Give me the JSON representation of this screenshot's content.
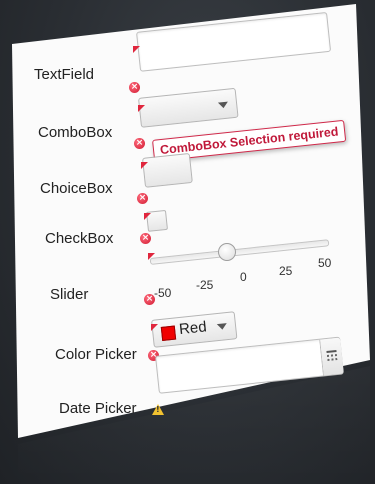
{
  "form": {
    "labels": {
      "textfield": "TextField",
      "combobox": "ComboBox",
      "choicebox": "ChoiceBox",
      "checkbox": "CheckBox",
      "slider": "Slider",
      "colorpicker": "Color Picker",
      "datepicker": "Date Picker"
    },
    "textfield": {
      "value": ""
    },
    "combobox": {
      "value": "",
      "tooltip": "ComboBox Selection required"
    },
    "slider": {
      "min": -50,
      "max": 50,
      "value": 0,
      "tick_labels": [
        "-50",
        "-25",
        "0",
        "25",
        "50"
      ]
    },
    "colorpicker": {
      "value": "Red",
      "color": "#ff0000"
    },
    "datepicker": {
      "value": ""
    }
  },
  "icons": {
    "error": "error-circle-icon",
    "warning": "warning-triangle-icon",
    "dropdown": "chevron-down-icon",
    "calendar": "calendar-icon"
  },
  "colors": {
    "error": "#d01a31",
    "warning": "#f2c230",
    "card": "#fbfbfb"
  }
}
